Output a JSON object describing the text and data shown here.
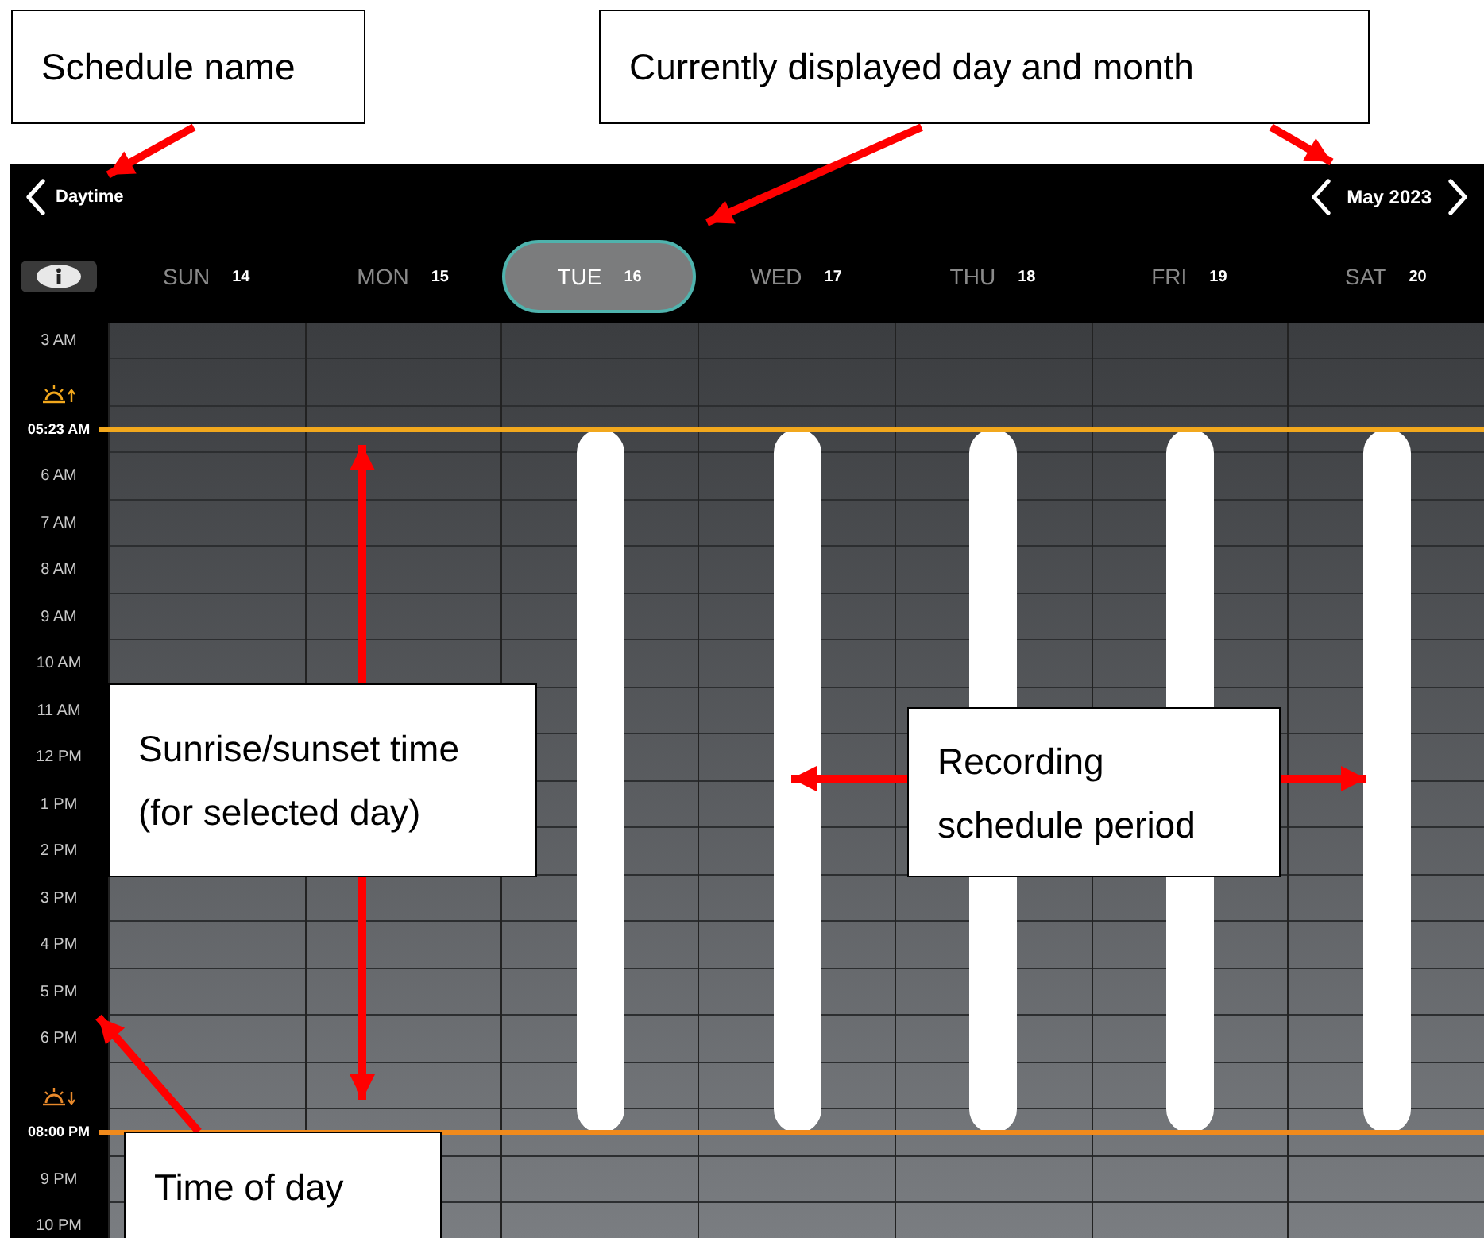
{
  "callouts": [
    {
      "lines": [
        "Schedule name"
      ]
    },
    {
      "lines": [
        "Currently displayed day and month"
      ]
    },
    {
      "lines": [
        "Sunrise/sunset time",
        "(for selected day)"
      ]
    },
    {
      "lines": [
        "Recording",
        "schedule period"
      ]
    },
    {
      "lines": [
        "Time of day"
      ]
    }
  ],
  "header": {
    "schedule_name": "Daytime",
    "month": "May 2023"
  },
  "info_toggle": {
    "on": true
  },
  "days": [
    {
      "name": "SUN",
      "date": "14",
      "selected": false,
      "recording": false
    },
    {
      "name": "MON",
      "date": "15",
      "selected": false,
      "recording": false
    },
    {
      "name": "TUE",
      "date": "16",
      "selected": true,
      "recording": true
    },
    {
      "name": "WED",
      "date": "17",
      "selected": false,
      "recording": true
    },
    {
      "name": "THU",
      "date": "18",
      "selected": false,
      "recording": true
    },
    {
      "name": "FRI",
      "date": "19",
      "selected": false,
      "recording": true
    },
    {
      "name": "SAT",
      "date": "20",
      "selected": false,
      "recording": true
    }
  ],
  "time_labels": [
    {
      "text": "3 AM",
      "kind": "hour"
    },
    {
      "text": "05:23 AM",
      "kind": "sunrise"
    },
    {
      "text": "6 AM",
      "kind": "hour"
    },
    {
      "text": "7 AM",
      "kind": "hour"
    },
    {
      "text": "8 AM",
      "kind": "hour"
    },
    {
      "text": "9 AM",
      "kind": "hour"
    },
    {
      "text": "10 AM",
      "kind": "hour"
    },
    {
      "text": "11 AM",
      "kind": "hour"
    },
    {
      "text": "12 PM",
      "kind": "hour"
    },
    {
      "text": "1 PM",
      "kind": "hour"
    },
    {
      "text": "2 PM",
      "kind": "hour"
    },
    {
      "text": "3 PM",
      "kind": "hour"
    },
    {
      "text": "4 PM",
      "kind": "hour"
    },
    {
      "text": "5 PM",
      "kind": "hour"
    },
    {
      "text": "6 PM",
      "kind": "hour"
    },
    {
      "text": "08:00 PM",
      "kind": "sunset"
    },
    {
      "text": "9 PM",
      "kind": "hour"
    },
    {
      "text": "10 PM",
      "kind": "hour"
    }
  ]
}
